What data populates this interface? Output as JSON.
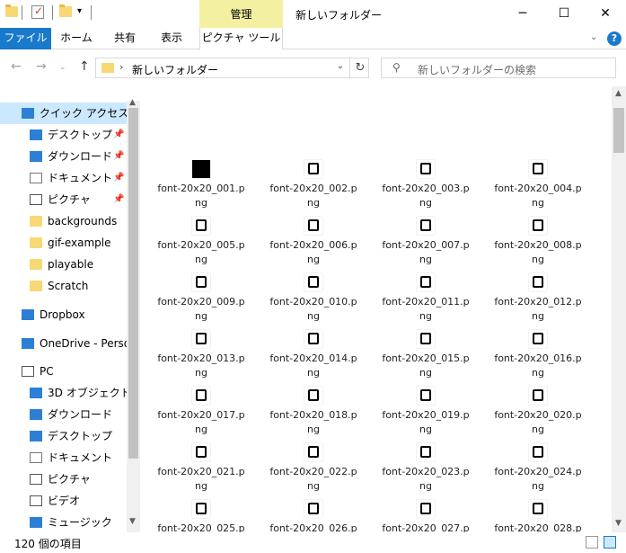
{
  "title_bar": {
    "manage_tab": "管理",
    "window_title": "新しいフォルダー",
    "minimize": "─",
    "maximize": "☐",
    "close": "✕"
  },
  "ribbon_tabs": {
    "file": "ファイル",
    "home": "ホーム",
    "share": "共有",
    "view": "表示",
    "picture_tools": "ピクチャ ツール"
  },
  "address": {
    "path": "新しいフォルダー",
    "search_placeholder": "新しいフォルダーの検索"
  },
  "nav_pane": {
    "quick_access": "クイック アクセス",
    "items": [
      {
        "label": "デスクトップ",
        "icon": "desktop-icon",
        "pinned": true
      },
      {
        "label": "ダウンロード",
        "icon": "download-icon",
        "pinned": true
      },
      {
        "label": "ドキュメント",
        "icon": "document-icon",
        "pinned": true
      },
      {
        "label": "ピクチャ",
        "icon": "picture-icon",
        "pinned": true
      },
      {
        "label": "backgrounds",
        "icon": "folder-icon",
        "pinned": false
      },
      {
        "label": "gif-example",
        "icon": "folder-icon",
        "pinned": false
      },
      {
        "label": "playable",
        "icon": "folder-icon",
        "pinned": false
      },
      {
        "label": "Scratch",
        "icon": "folder-icon",
        "pinned": false
      }
    ],
    "dropbox": "Dropbox",
    "onedrive": "OneDrive - Persor",
    "pc": "PC",
    "pc_items": [
      {
        "label": "3D オブジェクト",
        "icon": "3d-objects-icon"
      },
      {
        "label": "ダウンロード",
        "icon": "download-icon"
      },
      {
        "label": "デスクトップ",
        "icon": "desktop-icon"
      },
      {
        "label": "ドキュメント",
        "icon": "document-icon"
      },
      {
        "label": "ピクチャ",
        "icon": "picture-icon"
      },
      {
        "label": "ビデオ",
        "icon": "video-icon"
      },
      {
        "label": "ミュージック",
        "icon": "music-icon"
      }
    ]
  },
  "files": [
    {
      "name1": "font-20x20_001.p",
      "name2": "ng"
    },
    {
      "name1": "font-20x20_002.p",
      "name2": "ng"
    },
    {
      "name1": "font-20x20_003.p",
      "name2": "ng"
    },
    {
      "name1": "font-20x20_004.p",
      "name2": "ng"
    },
    {
      "name1": "font-20x20_005.p",
      "name2": "ng"
    },
    {
      "name1": "font-20x20_006.p",
      "name2": "ng"
    },
    {
      "name1": "font-20x20_007.p",
      "name2": "ng"
    },
    {
      "name1": "font-20x20_008.p",
      "name2": "ng"
    },
    {
      "name1": "font-20x20_009.p",
      "name2": "ng"
    },
    {
      "name1": "font-20x20_010.p",
      "name2": "ng"
    },
    {
      "name1": "font-20x20_011.p",
      "name2": "ng"
    },
    {
      "name1": "font-20x20_012.p",
      "name2": "ng"
    },
    {
      "name1": "font-20x20_013.p",
      "name2": "ng"
    },
    {
      "name1": "font-20x20_014.p",
      "name2": "ng"
    },
    {
      "name1": "font-20x20_015.p",
      "name2": "ng"
    },
    {
      "name1": "font-20x20_016.p",
      "name2": "ng"
    },
    {
      "name1": "font-20x20_017.p",
      "name2": "ng"
    },
    {
      "name1": "font-20x20_018.p",
      "name2": "ng"
    },
    {
      "name1": "font-20x20_019.p",
      "name2": "ng"
    },
    {
      "name1": "font-20x20_020.p",
      "name2": "ng"
    },
    {
      "name1": "font-20x20_021.p",
      "name2": "ng"
    },
    {
      "name1": "font-20x20_022.p",
      "name2": "ng"
    },
    {
      "name1": "font-20x20_023.p",
      "name2": "ng"
    },
    {
      "name1": "font-20x20_024.p",
      "name2": "ng"
    },
    {
      "name1": "font-20x20_025.p",
      "name2": ""
    },
    {
      "name1": "font-20x20_026.p",
      "name2": ""
    },
    {
      "name1": "font-20x20_027.p",
      "name2": ""
    },
    {
      "name1": "font-20x20_028.p",
      "name2": ""
    }
  ],
  "status": {
    "item_count": "120 個の項目"
  },
  "colors": {
    "accent": "#1979ca",
    "manage_tab": "#f4f0a2",
    "selected_nav": "#cce8ff",
    "folder": "#f8d775"
  }
}
